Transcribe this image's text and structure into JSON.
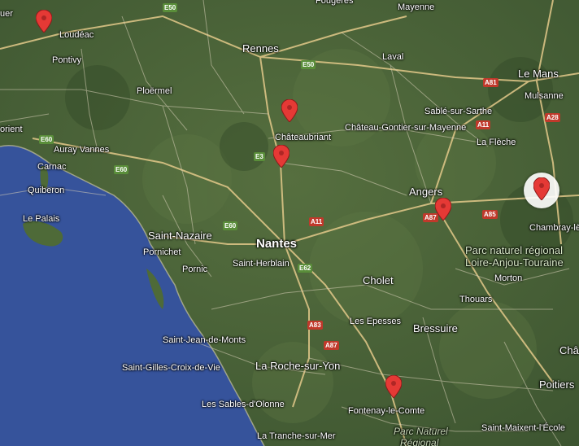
{
  "map": {
    "colors": {
      "land": "#4a6538",
      "sea": "#36539b",
      "road_major": "#e3c98a",
      "road_minor": "#d8d0b8",
      "pin": "#e53935"
    },
    "cities": [
      {
        "id": "rennes",
        "name": "Rennes",
        "cls": "mid"
      },
      {
        "id": "laval",
        "name": "Laval",
        "cls": ""
      },
      {
        "id": "mayenne",
        "name": "Mayenne",
        "cls": ""
      },
      {
        "id": "le-mans",
        "name": "Le Mans",
        "cls": "mid"
      },
      {
        "id": "mulsanne",
        "name": "Mulsanne",
        "cls": ""
      },
      {
        "id": "loudeac",
        "name": "Loudéac",
        "cls": ""
      },
      {
        "id": "pontivy",
        "name": "Pontivy",
        "cls": ""
      },
      {
        "id": "ploermel",
        "name": "Ploërmel",
        "cls": ""
      },
      {
        "id": "orient",
        "name": "orient",
        "cls": ""
      },
      {
        "id": "auray-vannes",
        "name": "Auray Vannes",
        "cls": ""
      },
      {
        "id": "carnac",
        "name": "Carnac",
        "cls": ""
      },
      {
        "id": "quiberon",
        "name": "Quiberon",
        "cls": ""
      },
      {
        "id": "le-palais",
        "name": "Le Palais",
        "cls": ""
      },
      {
        "id": "sable",
        "name": "Sablé-sur-Sarthe",
        "cls": ""
      },
      {
        "id": "chateau-gontier",
        "name": "Château-Gontier-sur-Mayenne",
        "cls": ""
      },
      {
        "id": "chateaubriant",
        "name": "Châteaubriant",
        "cls": ""
      },
      {
        "id": "la-fleche",
        "name": "La Flèche",
        "cls": ""
      },
      {
        "id": "angers",
        "name": "Angers",
        "cls": "mid"
      },
      {
        "id": "chambray",
        "name": "Chambray-lè",
        "cls": ""
      },
      {
        "id": "saint-nazaire",
        "name": "Saint-Nazaire",
        "cls": "mid"
      },
      {
        "id": "pornichet",
        "name": "Pornichet",
        "cls": ""
      },
      {
        "id": "nantes",
        "name": "Nantes",
        "cls": "big"
      },
      {
        "id": "saint-herblain",
        "name": "Saint-Herblain",
        "cls": ""
      },
      {
        "id": "pornic",
        "name": "Pornic",
        "cls": ""
      },
      {
        "id": "cholet",
        "name": "Cholet",
        "cls": "mid"
      },
      {
        "id": "morton",
        "name": "Morton",
        "cls": ""
      },
      {
        "id": "thouars",
        "name": "Thouars",
        "cls": ""
      },
      {
        "id": "les-epesses",
        "name": "Les Epesses",
        "cls": ""
      },
      {
        "id": "bressuire",
        "name": "Bressuire",
        "cls": "mid"
      },
      {
        "id": "saint-jean",
        "name": "Saint-Jean-de-Monts",
        "cls": ""
      },
      {
        "id": "saint-gilles",
        "name": "Saint-Gilles-Croix-de-Vie",
        "cls": ""
      },
      {
        "id": "la-roche",
        "name": "La Roche-sur-Yon",
        "cls": "mid"
      },
      {
        "id": "sables",
        "name": "Les Sables-d'Olonne",
        "cls": ""
      },
      {
        "id": "fontenay",
        "name": "Fontenay-le-Comte",
        "cls": ""
      },
      {
        "id": "la-tranche",
        "name": "La Tranche-sur-Mer",
        "cls": ""
      },
      {
        "id": "poitiers",
        "name": "Poitiers",
        "cls": "mid"
      },
      {
        "id": "saint-maixent",
        "name": "Saint-Maixent-l'École",
        "cls": ""
      },
      {
        "id": "cha",
        "name": "Châ",
        "cls": "mid"
      },
      {
        "id": "uer",
        "name": "uer",
        "cls": ""
      },
      {
        "id": "fougeres-top",
        "name": "Fougères",
        "cls": ""
      }
    ],
    "parks": [
      {
        "id": "park-loire",
        "line1": "Parc naturel régional",
        "line2": "Loire-Anjou-Touraine"
      },
      {
        "id": "park-marais",
        "line1": "Parc Naturel",
        "line2": "Régional"
      }
    ],
    "roads": [
      {
        "id": "e50-top",
        "label": "E50",
        "color": "green"
      },
      {
        "id": "e50-rennes",
        "label": "E50",
        "color": "green"
      },
      {
        "id": "a81",
        "label": "A81",
        "color": "red"
      },
      {
        "id": "a11-top",
        "label": "A11",
        "color": "red"
      },
      {
        "id": "a28",
        "label": "A28",
        "color": "red"
      },
      {
        "id": "e60-west",
        "label": "E60",
        "color": "green"
      },
      {
        "id": "e60-mid",
        "label": "E60",
        "color": "green"
      },
      {
        "id": "e3",
        "label": "E3",
        "color": "green"
      },
      {
        "id": "e60-nantes",
        "label": "E60",
        "color": "green"
      },
      {
        "id": "a11-nantes",
        "label": "A11",
        "color": "red"
      },
      {
        "id": "a87-angers",
        "label": "A87",
        "color": "red"
      },
      {
        "id": "a85",
        "label": "A85",
        "color": "red"
      },
      {
        "id": "e62",
        "label": "E62",
        "color": "green"
      },
      {
        "id": "a83",
        "label": "A83",
        "color": "red"
      },
      {
        "id": "a87-south",
        "label": "A87",
        "color": "red"
      }
    ],
    "markers": [
      {
        "id": "marker-1",
        "icon": "map-pin-icon",
        "selected": false
      },
      {
        "id": "marker-2",
        "icon": "map-pin-icon",
        "selected": false
      },
      {
        "id": "marker-3",
        "icon": "map-pin-icon",
        "selected": false
      },
      {
        "id": "marker-4",
        "icon": "map-pin-icon",
        "selected": false
      },
      {
        "id": "marker-5",
        "icon": "map-pin-icon",
        "selected": true
      },
      {
        "id": "marker-6",
        "icon": "map-pin-icon",
        "selected": false
      }
    ]
  }
}
